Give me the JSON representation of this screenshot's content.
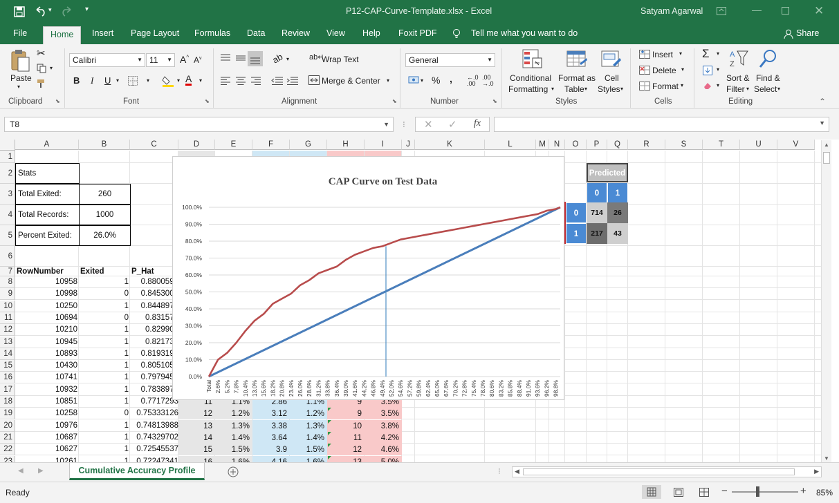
{
  "titlebar": {
    "file_title": "P12-CAP-Curve-Template.xlsx  -  Excel",
    "user": "Satyam Agarwal"
  },
  "tabs": [
    "File",
    "Home",
    "Insert",
    "Page Layout",
    "Formulas",
    "Data",
    "Review",
    "View",
    "Help",
    "Foxit PDF"
  ],
  "tell_me": "Tell me what you want to do",
  "share": "Share",
  "ribbon": {
    "paste": "Paste",
    "clipboard": "Clipboard",
    "font_name": "Calibri",
    "font_size": "11",
    "font": "Font",
    "bold": "B",
    "italic": "I",
    "underline": "U",
    "wrap_text": "Wrap Text",
    "merge_center": "Merge & Center",
    "alignment": "Alignment",
    "number_format": "General",
    "number": "Number",
    "percent": "%",
    "comma": ",",
    "cond_format_1": "Conditional",
    "cond_format_2": "Formatting",
    "format_as_1": "Format as",
    "format_as_2": "Table",
    "cell_styles_1": "Cell",
    "cell_styles_2": "Styles",
    "styles": "Styles",
    "insert": "Insert",
    "delete": "Delete",
    "format": "Format",
    "cells": "Cells",
    "sort_1": "Sort &",
    "sort_2": "Filter",
    "find_1": "Find &",
    "find_2": "Select",
    "editing": "Editing"
  },
  "formula_bar": {
    "name_box": "T8",
    "formula": "",
    "fx": "fx"
  },
  "columns": [
    "A",
    "B",
    "C",
    "D",
    "E",
    "F",
    "G",
    "H",
    "I",
    "J",
    "K",
    "L",
    "M",
    "N",
    "O",
    "P",
    "Q",
    "R",
    "S",
    "T",
    "U",
    "V"
  ],
  "stats": {
    "title": "Stats",
    "exited_label": "Total Exited:",
    "exited_value": "260",
    "records_label": "Total Records:",
    "records_value": "1000",
    "percent_label": "Percent Exited:",
    "percent_value": "26.0%"
  },
  "headers": {
    "row_number": "RowNumber",
    "exited": "Exited",
    "p_hat": "P_Hat"
  },
  "rows": [
    [
      "10958",
      "1",
      "0.8800594"
    ],
    [
      "10998",
      "0",
      "0.8453009"
    ],
    [
      "10250",
      "1",
      "0.8448971"
    ],
    [
      "10694",
      "0",
      "0.831573"
    ],
    [
      "10210",
      "1",
      "0.829908"
    ],
    [
      "10945",
      "1",
      "0.821731"
    ],
    [
      "10893",
      "1",
      "0.8193195"
    ],
    [
      "10430",
      "1",
      "0.8051054"
    ],
    [
      "10741",
      "1",
      "0.7979459"
    ],
    [
      "10932",
      "1",
      "0.7838976"
    ],
    [
      "10851",
      "1",
      "0.7717293"
    ],
    [
      "10258",
      "0",
      "0.75333126"
    ],
    [
      "10976",
      "1",
      "0.74813988"
    ],
    [
      "10687",
      "1",
      "0.74329702"
    ],
    [
      "10627",
      "1",
      "0.72545537"
    ],
    [
      "10261",
      "1",
      "0.72247341"
    ]
  ],
  "hidden_rows": [
    [
      "11",
      "1.1%",
      "2.86",
      "1.1%",
      "9",
      "3.5%"
    ],
    [
      "12",
      "1.2%",
      "3.12",
      "1.2%",
      "9",
      "3.5%"
    ],
    [
      "13",
      "1.3%",
      "3.38",
      "1.3%",
      "10",
      "3.8%"
    ],
    [
      "14",
      "1.4%",
      "3.64",
      "1.4%",
      "11",
      "4.2%"
    ],
    [
      "15",
      "1.5%",
      "3.9",
      "1.5%",
      "12",
      "4.6%"
    ],
    [
      "16",
      "1.6%",
      "4.16",
      "1.6%",
      "13",
      "5.0%"
    ]
  ],
  "confusion": {
    "predicted": "Predicted",
    "col0": "0",
    "col1": "1",
    "row0": "0",
    "row1": "1",
    "tn": "714",
    "fp": "26",
    "fn": "217",
    "tp": "43"
  },
  "sheet_tab": "Cumulative Accuracy Profile",
  "status": {
    "ready": "Ready",
    "zoom": "85%"
  },
  "colors": {
    "excel_green": "#217346",
    "model_line": "#b84c4c",
    "random_line": "#4a7ebb",
    "vertical_line": "#4f8fc5"
  },
  "chart_data": {
    "type": "line",
    "title": "CAP Curve on Test Data",
    "xlabel": "",
    "ylabel": "",
    "ylim": [
      0,
      1
    ],
    "y_ticks": [
      "0.0%",
      "10.0%",
      "20.0%",
      "30.0%",
      "40.0%",
      "50.0%",
      "60.0%",
      "70.0%",
      "80.0%",
      "90.0%",
      "100.0%"
    ],
    "x_ticks": [
      "Total",
      "2.6%",
      "5.2%",
      "7.8%",
      "10.4%",
      "13.0%",
      "15.6%",
      "18.2%",
      "20.8%",
      "23.4%",
      "26.0%",
      "28.6%",
      "31.2%",
      "33.8%",
      "36.4%",
      "39.0%",
      "41.6%",
      "44.2%",
      "46.8%",
      "49.4%",
      "52.0%",
      "54.6%",
      "57.2%",
      "59.8%",
      "62.4%",
      "65.0%",
      "67.6%",
      "70.2%",
      "72.8%",
      "75.4%",
      "78.0%",
      "80.6%",
      "83.2%",
      "85.8%",
      "88.4%",
      "91.0%",
      "93.6%",
      "96.2%",
      "98.8%"
    ],
    "series": [
      {
        "x": [
          0,
          0.026,
          0.052,
          0.078,
          0.104,
          0.13,
          0.156,
          0.182,
          0.208,
          0.234,
          0.26,
          0.286,
          0.312,
          0.338,
          0.364,
          0.39,
          0.416,
          0.442,
          0.468,
          0.494,
          0.52,
          0.546,
          0.572,
          0.598,
          0.624,
          0.65,
          0.676,
          0.702,
          0.728,
          0.754,
          0.78,
          0.806,
          0.832,
          0.858,
          0.884,
          0.91,
          0.936,
          0.962,
          0.988,
          1.0
        ],
        "values": [
          0,
          0.1,
          0.14,
          0.2,
          0.27,
          0.33,
          0.37,
          0.43,
          0.46,
          0.49,
          0.54,
          0.57,
          0.61,
          0.63,
          0.65,
          0.69,
          0.72,
          0.74,
          0.76,
          0.77,
          0.79,
          0.81,
          0.82,
          0.83,
          0.84,
          0.85,
          0.86,
          0.87,
          0.88,
          0.89,
          0.9,
          0.91,
          0.92,
          0.93,
          0.94,
          0.95,
          0.96,
          0.98,
          0.99,
          1.0
        ]
      },
      {
        "x": [
          0,
          1
        ],
        "values": [
          0,
          1
        ]
      }
    ],
    "vertical_marker_x": 0.5,
    "vertical_marker_y": 0.77
  }
}
